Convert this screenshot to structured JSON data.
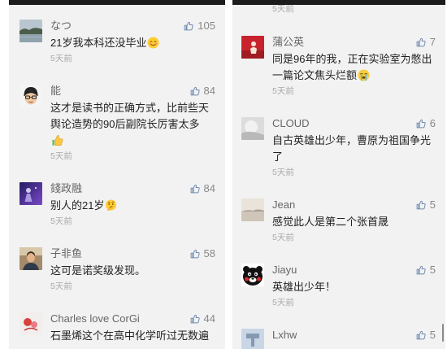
{
  "colors": {
    "panel_background": "#f2f2f2",
    "status_bar": "#1c1c1c",
    "username": "#666666",
    "comment_text": "#222222",
    "timestamp": "#aaaaaa",
    "like_icon": "#6f8bb0",
    "like_count": "#888888"
  },
  "left_panel": {
    "comments": [
      {
        "avatar": "landscape-photo-avatar",
        "user": "なつ",
        "likes": 105,
        "text_lines": [
          "21岁我本科还没毕业"
        ],
        "emoji": "smiling-face",
        "time": "5天前"
      },
      {
        "avatar": "cartoon-glasses-avatar",
        "user": "能",
        "likes": 84,
        "text_lines": [
          "这才是读书的正确方式，比前些天",
          "舆论造势的90后副院长厉害太多"
        ],
        "emoji": "thumbs-up",
        "time": "5天前"
      },
      {
        "avatar": "purple-avatar",
        "user": "錢政融",
        "likes": 84,
        "text_lines": [
          "别人的21岁"
        ],
        "emoji": "thinking-face",
        "time": "5天前"
      },
      {
        "avatar": "portrait-photo-avatar",
        "user": "子非鱼",
        "likes": 58,
        "text_lines": [
          "这可是诺奖级发现。"
        ],
        "time": "5天前"
      },
      {
        "avatar": "red-flower-avatar",
        "user": "Charles love CorGi",
        "likes": 44,
        "text_lines": [
          "石墨烯这个在高中化学听过无数遍"
        ]
      }
    ]
  },
  "right_panel": {
    "partial_time": "5天前",
    "comments": [
      {
        "avatar": "red-photo-avatar",
        "user": "蒲公英",
        "likes": 7,
        "text_lines": [
          "同是96年的我，正在实验室为憋出",
          "一篇论文焦头烂额"
        ],
        "emoji": "crying-face",
        "time": "5天前"
      },
      {
        "avatar": "light-gray-avatar",
        "user": "CLOUD",
        "likes": 6,
        "text_lines": [
          "自古英雄出少年，曹原为祖国争光",
          "了"
        ],
        "time": "5天前"
      },
      {
        "avatar": "pale-landscape-avatar",
        "user": "Jean",
        "likes": 5,
        "text_lines": [
          "感觉此人是第二个张首晟"
        ],
        "time": "5天前"
      },
      {
        "avatar": "kumamon-bear-avatar",
        "user": "Jiayu",
        "likes": 5,
        "text_lines": [
          "英雄出少年！"
        ],
        "time": "5天前"
      },
      {
        "avatar": "pale-blue-avatar",
        "user": "Lxhw",
        "likes": 5
      }
    ]
  }
}
